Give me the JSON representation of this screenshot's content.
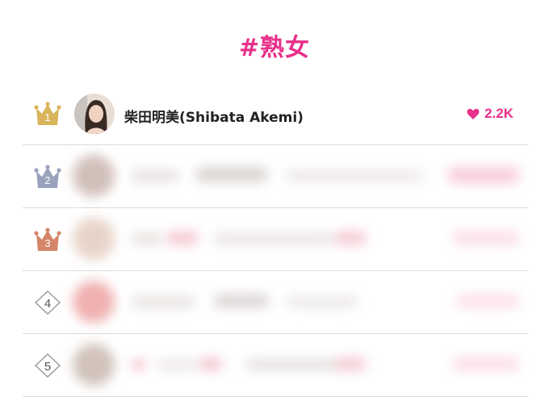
{
  "page": {
    "title": "#熟女"
  },
  "ranking": [
    {
      "rank": "1",
      "badge": "crown",
      "color": "#d9b45a",
      "name": "柴田明美(Shibata Akemi)",
      "likes": "2.2K",
      "blurred": false
    },
    {
      "rank": "2",
      "badge": "crown",
      "color": "#9aa3bd",
      "blurred": true
    },
    {
      "rank": "3",
      "badge": "crown",
      "color": "#d5866a",
      "blurred": true
    },
    {
      "rank": "4",
      "badge": "diamond",
      "color": "#999999",
      "blurred": true
    },
    {
      "rank": "5",
      "badge": "diamond",
      "color": "#999999",
      "blurred": true
    }
  ],
  "colors": {
    "accent": "#e8308a",
    "divider": "#dcdcdc"
  },
  "icons": {
    "like": "heart-icon",
    "rank_top3": "crown-icon",
    "rank_other": "diamond-icon"
  }
}
